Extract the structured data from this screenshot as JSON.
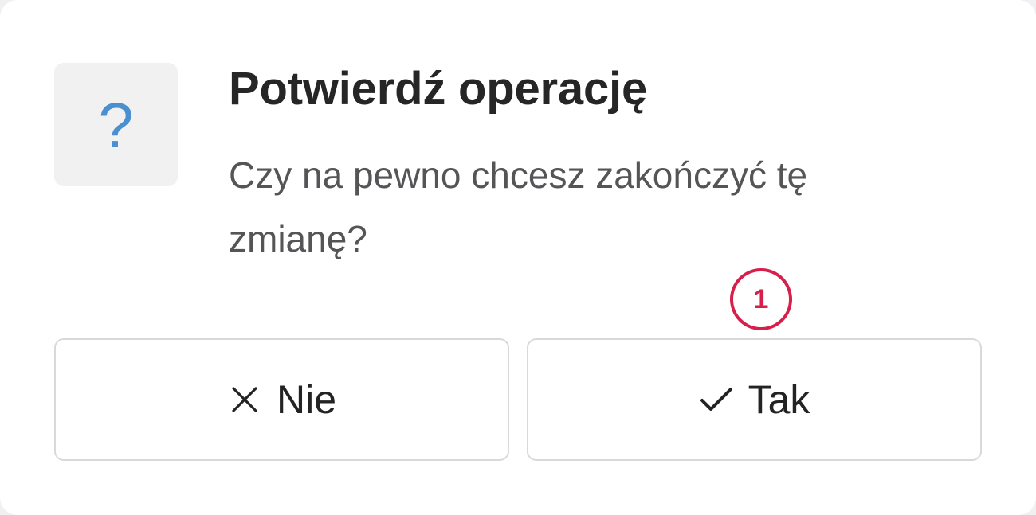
{
  "dialog": {
    "icon": "question-mark-icon",
    "icon_glyph": "?",
    "icon_color": "#4a90d0",
    "title": "Potwierdź operację",
    "message": "Czy na pewno chcesz zakończyć tę zmianę?",
    "annotation_badge": "1",
    "annotation_color": "#d61f4b",
    "buttons": {
      "no": {
        "label": "Nie",
        "icon": "close-icon"
      },
      "yes": {
        "label": "Tak",
        "icon": "check-icon"
      }
    }
  }
}
